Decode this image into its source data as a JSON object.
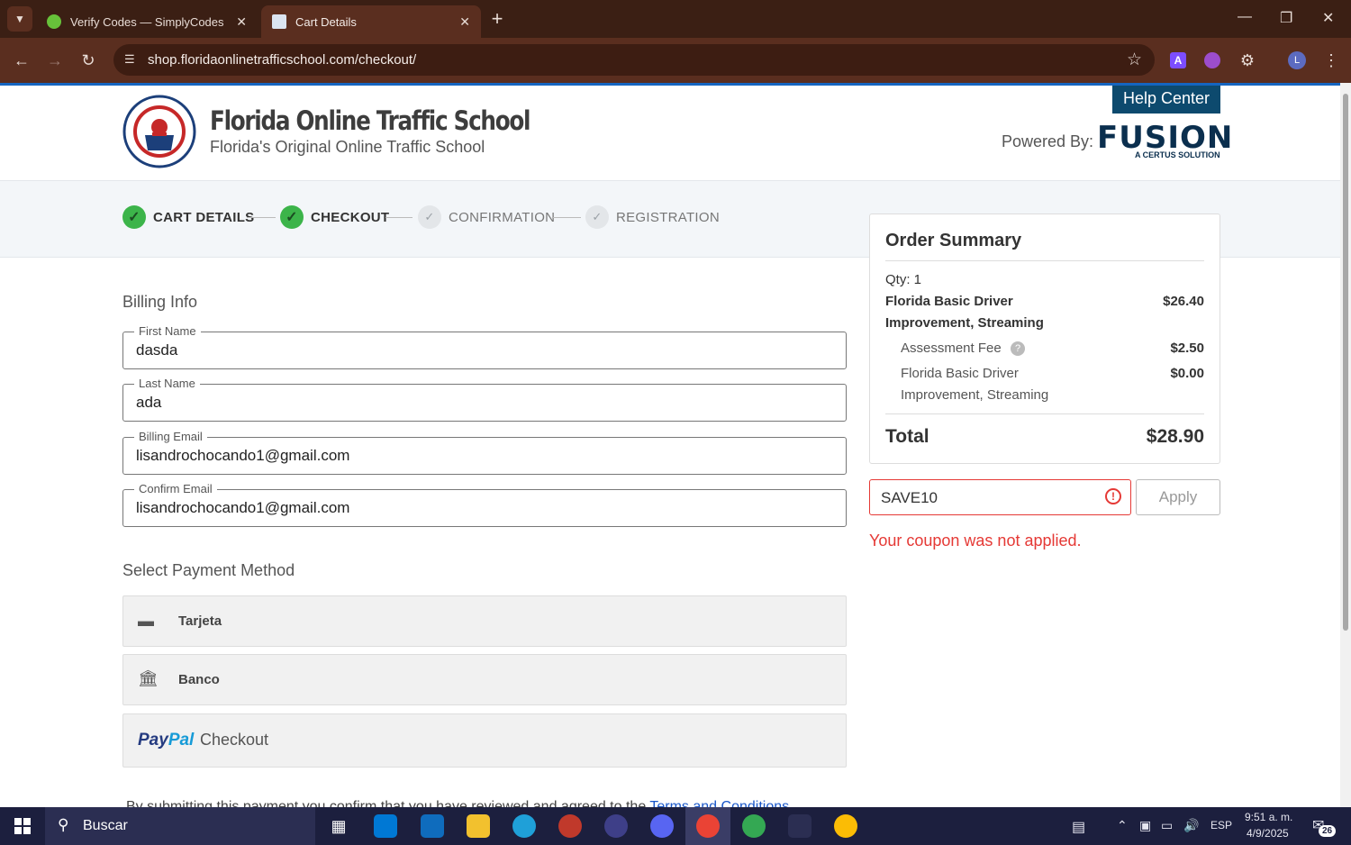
{
  "browser": {
    "tabs": [
      {
        "title": "Verify Codes — SimplyCodes",
        "active": false
      },
      {
        "title": "Cart Details",
        "active": true
      }
    ],
    "url": "shop.floridaonlinetrafficschool.com/checkout/",
    "new_tab": "+"
  },
  "header": {
    "school_name": "Florida Online Traffic School",
    "tagline": "Florida's Original Online Traffic School",
    "help_center": "Help Center",
    "powered_by": "Powered By:",
    "fusion": "FUSION",
    "certus": "A CERTUS SOLUTION"
  },
  "steps": [
    {
      "label": "CART DETAILS",
      "state": "done"
    },
    {
      "label": "CHECKOUT",
      "state": "done"
    },
    {
      "label": "CONFIRMATION",
      "state": "todo"
    },
    {
      "label": "REGISTRATION",
      "state": "todo"
    }
  ],
  "billing": {
    "title": "Billing Info",
    "fields": [
      {
        "label": "First Name",
        "value": "dasda"
      },
      {
        "label": "Last Name",
        "value": "ada"
      },
      {
        "label": "Billing Email",
        "value": "lisandrochocando1@gmail.com"
      },
      {
        "label": "Confirm Email",
        "value": "lisandrochocando1@gmail.com"
      }
    ]
  },
  "payment": {
    "title": "Select Payment Method",
    "card": "Tarjeta",
    "bank": "Banco",
    "paypal_pay": "Pay",
    "paypal_pal": "Pal",
    "paypal_checkout": "Checkout"
  },
  "terms": {
    "text": "By submitting this payment you confirm that you have reviewed and agreed to the ",
    "link": "Terms and Conditions"
  },
  "summary": {
    "title": "Order Summary",
    "qty": "Qty: 1",
    "item_line1": "Florida Basic Driver",
    "item_line2": "Improvement, Streaming",
    "item_price": "$26.40",
    "fee_label": "Assessment Fee",
    "fee_price": "$2.50",
    "sub_line1": "Florida Basic Driver",
    "sub_line2": "Improvement, Streaming",
    "sub_price": "$0.00",
    "total_label": "Total",
    "total_value": "$28.90"
  },
  "coupon": {
    "value": "SAVE10",
    "apply": "Apply",
    "error": "Your coupon was not applied."
  },
  "taskbar": {
    "search": "Buscar",
    "lang": "ESP",
    "time": "9:51 a. m.",
    "date": "4/9/2025",
    "notifications": "26"
  },
  "colors": {
    "brand": "#0d4a6e",
    "success": "#3cb44a",
    "error": "#e53935",
    "link": "#1a57c9"
  }
}
